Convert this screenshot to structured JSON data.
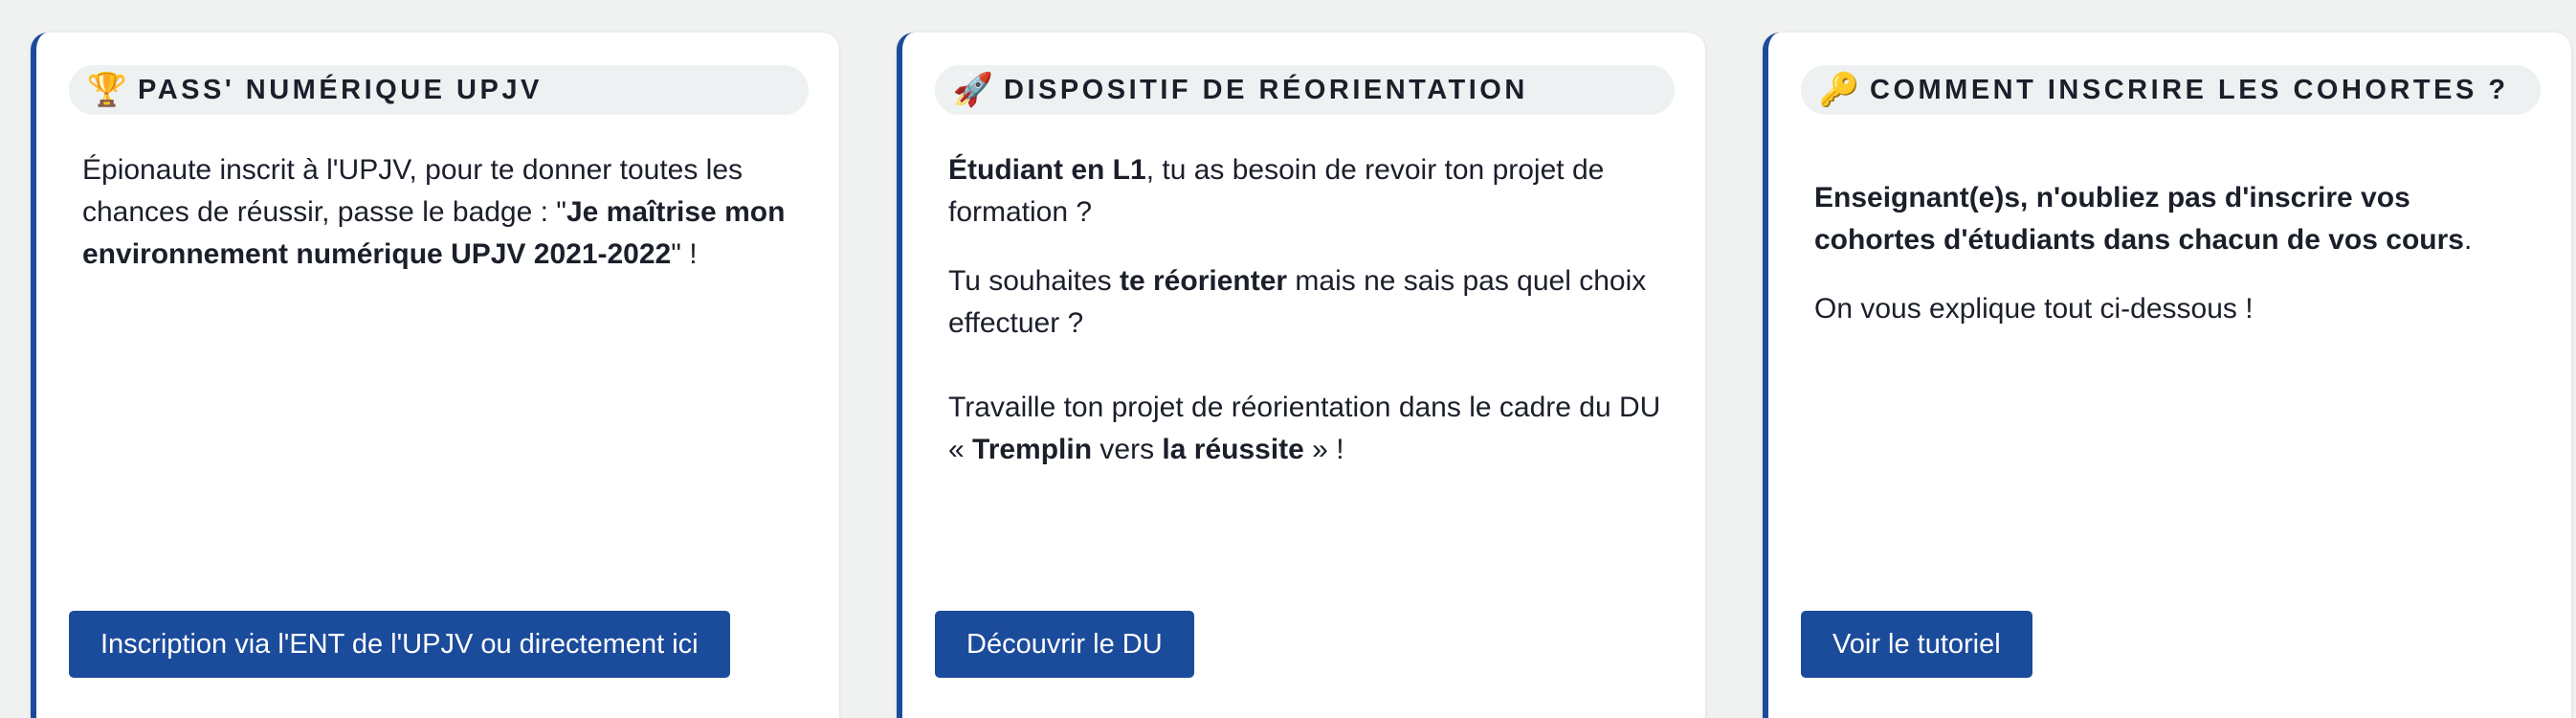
{
  "colors": {
    "accent": "#1b4b9b",
    "background": "#f0f2f1",
    "header_pill": "#eef1f1",
    "text": "#1b1f2a"
  },
  "cards": [
    {
      "icon": "trophy-icon",
      "icon_glyph": "🏆",
      "title": "PASS' NUMÉRIQUE UPJV",
      "body": {
        "p1_part1": "Épionaute inscrit à l'UPJV, pour te donner toutes les chances de réussir, passe le badge : \"",
        "p1_bold1": "Je maîtrise mon",
        "p1_bold2": "environnement numérique UPJV 2021-2022",
        "p1_part2": "\" !"
      },
      "button_label": "Inscription via l'ENT de l'UPJV ou directement ici"
    },
    {
      "icon": "rocket-icon",
      "icon_glyph": "🚀",
      "title": "DISPOSITIF DE RÉORIENTATION",
      "body": {
        "p1_bold": "Étudiant en L1",
        "p1_rest": ", tu as besoin de revoir ton projet de formation ?",
        "p2_part1": "Tu souhaites ",
        "p2_bold": "te réorienter",
        "p2_part2": " mais ne sais pas quel choix effectuer ?",
        "p3_part1": "Travaille ton projet de réorientation dans le cadre du DU « ",
        "p3_bold1": "Tremplin",
        "p3_part2": " vers ",
        "p3_bold2": "la réussite",
        "p3_part3": " » !"
      },
      "button_label": "Découvrir le DU"
    },
    {
      "icon": "key-icon",
      "icon_glyph": "🔑",
      "title": "COMMENT INSCRIRE LES COHORTES ?",
      "body": {
        "p1_bold": "Enseignant(e)s, n'oubliez pas d'inscrire vos cohortes d'étudiants dans chacun de vos cours",
        "p1_rest": ".",
        "p2": "On vous explique tout ci-dessous !"
      },
      "button_label": "Voir le tutoriel"
    }
  ]
}
